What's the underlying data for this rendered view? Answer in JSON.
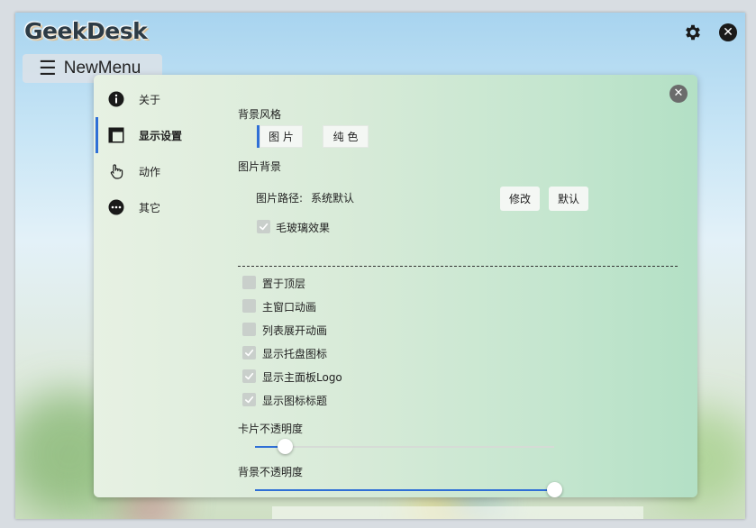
{
  "app": {
    "logo_text": "GeekDesk",
    "new_menu_label": "NewMenu",
    "gear_icon": "gear-icon",
    "close_icon": "close-icon"
  },
  "colors": {
    "accent": "#2f6fd6",
    "panel_start": "#e7f1e3",
    "panel_end": "#b3e0c5"
  },
  "nav": {
    "items": [
      {
        "label": "关于",
        "icon": "info-icon"
      },
      {
        "label": "显示设置",
        "icon": "layout-icon"
      },
      {
        "label": "动作",
        "icon": "hand-pointer-icon"
      },
      {
        "label": "其它",
        "icon": "more-icon"
      }
    ],
    "active_index": 1
  },
  "display": {
    "bg_style_title": "背景风格",
    "bg_style_tabs": [
      "图 片",
      "纯 色"
    ],
    "bg_style_selected": "图 片",
    "bg_image_title": "图片背景",
    "image_path_label": "图片路径:",
    "image_path_value": "系统默认",
    "modify_label": "修改",
    "default_label": "默认",
    "frosted_glass_label": "毛玻璃效果",
    "frosted_glass_checked": true,
    "options": [
      {
        "label": "置于顶层",
        "checked": false
      },
      {
        "label": "主窗口动画",
        "checked": false
      },
      {
        "label": "列表展开动画",
        "checked": false
      },
      {
        "label": "显示托盘图标",
        "checked": true
      },
      {
        "label": "显示主面板Logo",
        "checked": true
      },
      {
        "label": "显示图标标题",
        "checked": true
      }
    ],
    "card_opacity_label": "卡片不透明度",
    "card_opacity_value": 0.1,
    "bg_opacity_label": "背景不透明度",
    "bg_opacity_value": 1.0
  }
}
